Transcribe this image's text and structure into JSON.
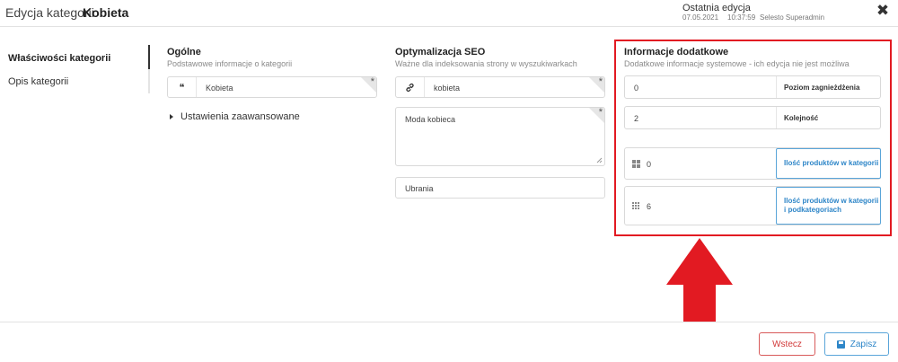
{
  "header": {
    "title_prefix": "Edycja kategorii:",
    "title_name": "Kobieta",
    "last_edit_label": "Ostatnia edycja",
    "last_edit_date": "07.05.2021",
    "last_edit_time": "10:37:59",
    "last_edit_user": "Selesto Superadmin",
    "close_icon": "close-icon"
  },
  "sidebar": {
    "items": [
      {
        "label": "Właściwości kategorii",
        "active": true
      },
      {
        "label": "Opis kategorii",
        "active": false
      }
    ]
  },
  "general": {
    "title": "Ogólne",
    "subtitle": "Podstawowe informacje o kategorii",
    "name_icon": "quote-icon",
    "name_value": "Kobieta",
    "advanced_label": "Ustawienia zaawansowane"
  },
  "seo": {
    "title": "Optymalizacja SEO",
    "subtitle": "Ważne dla indeksowania strony w wyszukiwarkach",
    "link_icon": "link-icon",
    "url_value": "kobieta",
    "meta_title_value": "Moda kobieca",
    "keywords_value": "Ubrania"
  },
  "info": {
    "title": "Informacje dodatkowe",
    "subtitle": "Dodatkowe informacje systemowe - ich edycja nie jest możliwa",
    "nesting_value": "0",
    "nesting_label": "Poziom zagnieżdżenia",
    "order_value": "2",
    "order_label": "Kolejność",
    "products_in_category_value": "0",
    "products_in_category_label": "Ilość produktów w kategorii",
    "products_in_subcategories_value": "6",
    "products_in_subcategories_label": "Ilość produktów w kategorii i podkategoriach"
  },
  "annotation": {
    "highlight_color": "#e21a22",
    "arrow_color": "#e21a22"
  },
  "footer": {
    "back_label": "Wstecz",
    "save_label": "Zapisz",
    "save_icon": "save-icon"
  },
  "colors": {
    "accent_blue": "#2e86c8",
    "danger_red": "#d23a3a"
  }
}
